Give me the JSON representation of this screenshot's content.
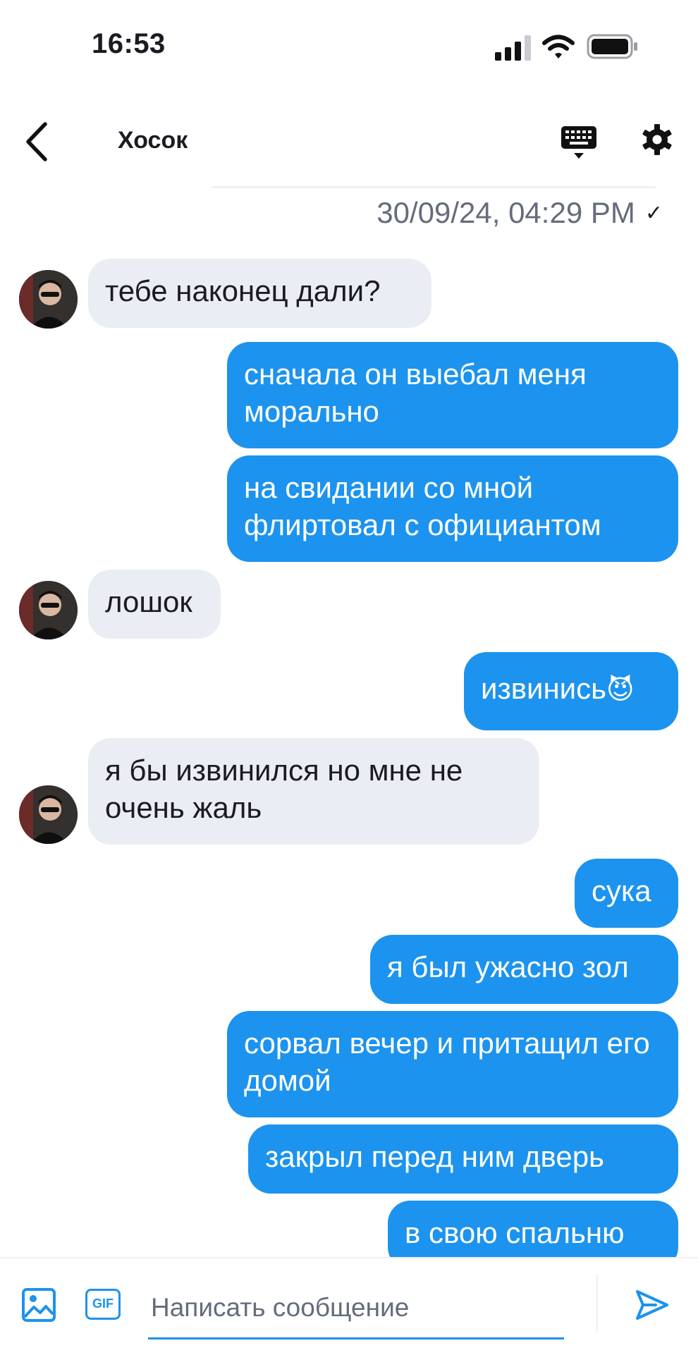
{
  "status_bar": {
    "time": "16:53"
  },
  "header": {
    "title": "Хосок"
  },
  "timestamp": {
    "text": "30/09/24, 04:29 PM",
    "check": "✓"
  },
  "messages": [
    {
      "from": "them",
      "text": "тебе наконец дали?"
    },
    {
      "from": "me",
      "text": "сначала он выебал меня морально"
    },
    {
      "from": "me",
      "text": "на свидании со мной флиртовал с официантом"
    },
    {
      "from": "them",
      "text": "лошок"
    },
    {
      "from": "me",
      "text": "извинись",
      "emoji": "😈"
    },
    {
      "from": "them",
      "text": "я бы извинился но мне не очень жаль"
    },
    {
      "from": "me",
      "text": "сука"
    },
    {
      "from": "me",
      "text": "я был ужасно зол"
    },
    {
      "from": "me",
      "text": "сорвал вечер и притащил его домой"
    },
    {
      "from": "me",
      "text": "закрыл перед ним дверь"
    },
    {
      "from": "me",
      "text": "в свою спальню"
    }
  ],
  "composer": {
    "placeholder": "Написать сообщение",
    "gif_label": "GIF"
  },
  "colors": {
    "accent": "#1c93ee",
    "incoming_bubble": "#eaedf3",
    "timestamp": "#646c7c"
  },
  "icons": [
    "back-arrow-icon",
    "keyboard-icon",
    "gear-icon",
    "image-icon",
    "gif-icon",
    "send-icon",
    "signal-icon",
    "wifi-icon",
    "battery-icon"
  ]
}
